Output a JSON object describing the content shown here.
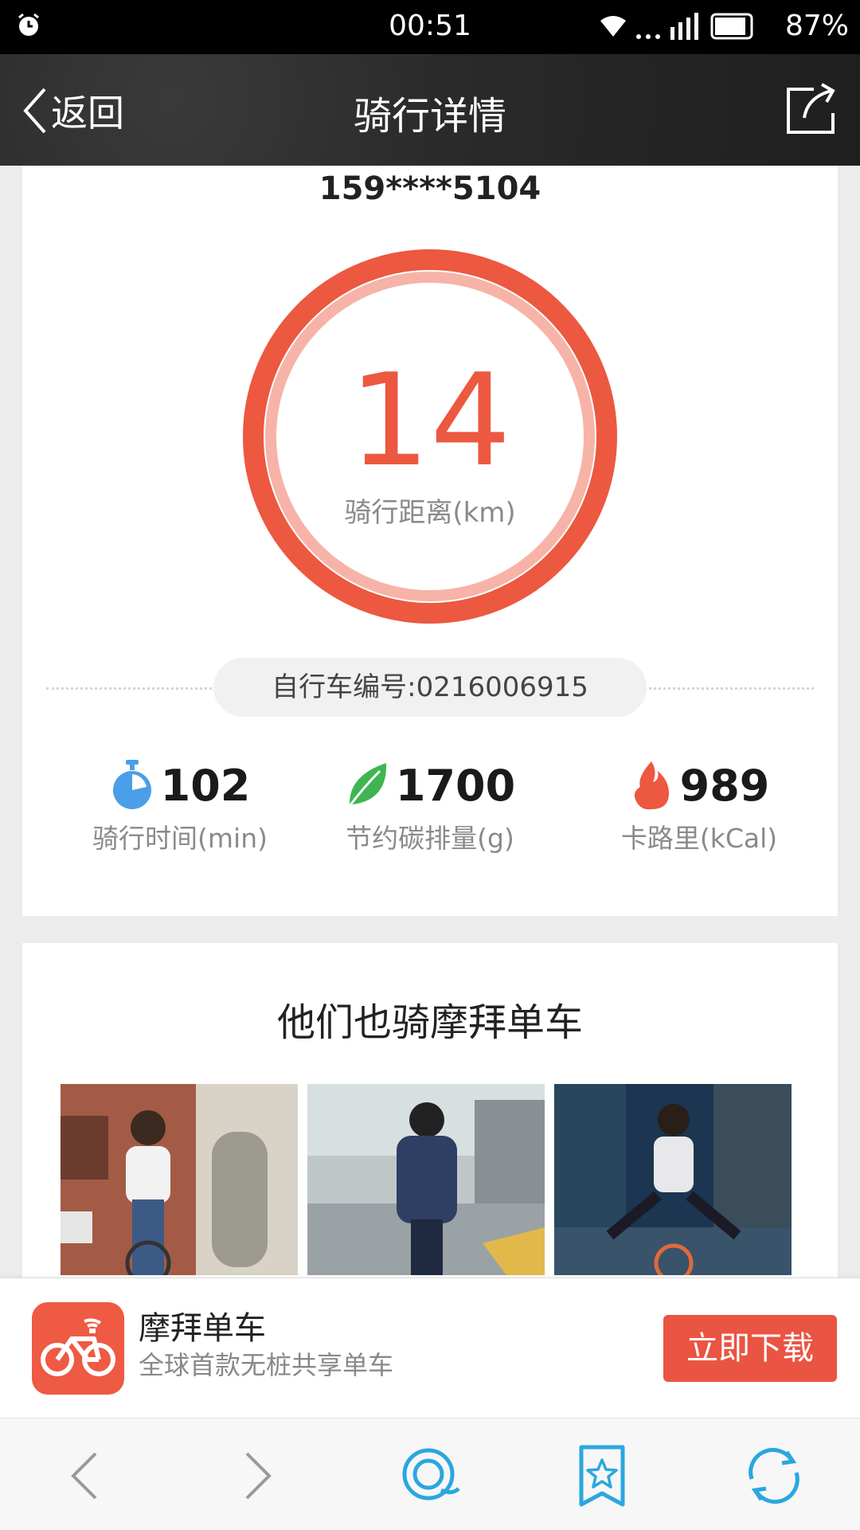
{
  "status_bar": {
    "time": "00:51",
    "battery": "87%"
  },
  "header": {
    "back_label": "返回",
    "title": "骑行详情"
  },
  "ride": {
    "phone": "159****5104",
    "distance_value": "14",
    "distance_label": "骑行距离(km)",
    "bike_number": "自行车编号:0216006915",
    "stats": [
      {
        "icon": "stopwatch-icon",
        "value": "102",
        "label": "骑行时间(min)",
        "color": "#4a9fe8"
      },
      {
        "icon": "leaf-icon",
        "value": "1700",
        "label": "节约碳排量(g)",
        "color": "#3fb552"
      },
      {
        "icon": "flame-icon",
        "value": "989",
        "label": "卡路里(kCal)",
        "color": "#ec5840"
      }
    ]
  },
  "promo": {
    "heading": "他们也骑摩拜单车",
    "photos": [
      "rider-photo-woman-street",
      "rider-photo-man-back",
      "rider-photo-woman-night"
    ]
  },
  "ad": {
    "app_name": "摩拜单车",
    "app_desc": "全球首款无桩共享单车",
    "download_label": "立即下载"
  },
  "colors": {
    "accent": "#ec5840",
    "ring_inner": "#f7b3a7"
  }
}
